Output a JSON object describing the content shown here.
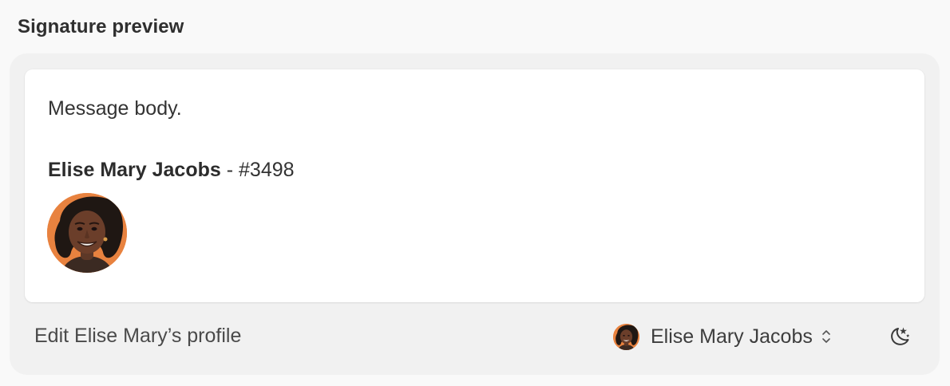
{
  "section": {
    "title": "Signature preview"
  },
  "preview": {
    "message_body": "Message body.",
    "signature": {
      "name": "Elise Mary Jacobs",
      "separator": " - ",
      "number": "#3498",
      "avatar_icon": "person-avatar-icon"
    }
  },
  "footer": {
    "edit_profile_label": "Edit Elise Mary’s profile",
    "selected_profile": {
      "name": "Elise Mary Jacobs",
      "avatar_icon": "person-avatar-icon",
      "chevron_icon": "chevron-up-down-icon"
    },
    "theme_toggle_icon": "moon-stars-icon"
  },
  "colors": {
    "page_background": "#f9f9f9",
    "panel_background": "#f1f1f1",
    "card_background": "#ffffff",
    "avatar_background": "#e8823f"
  }
}
